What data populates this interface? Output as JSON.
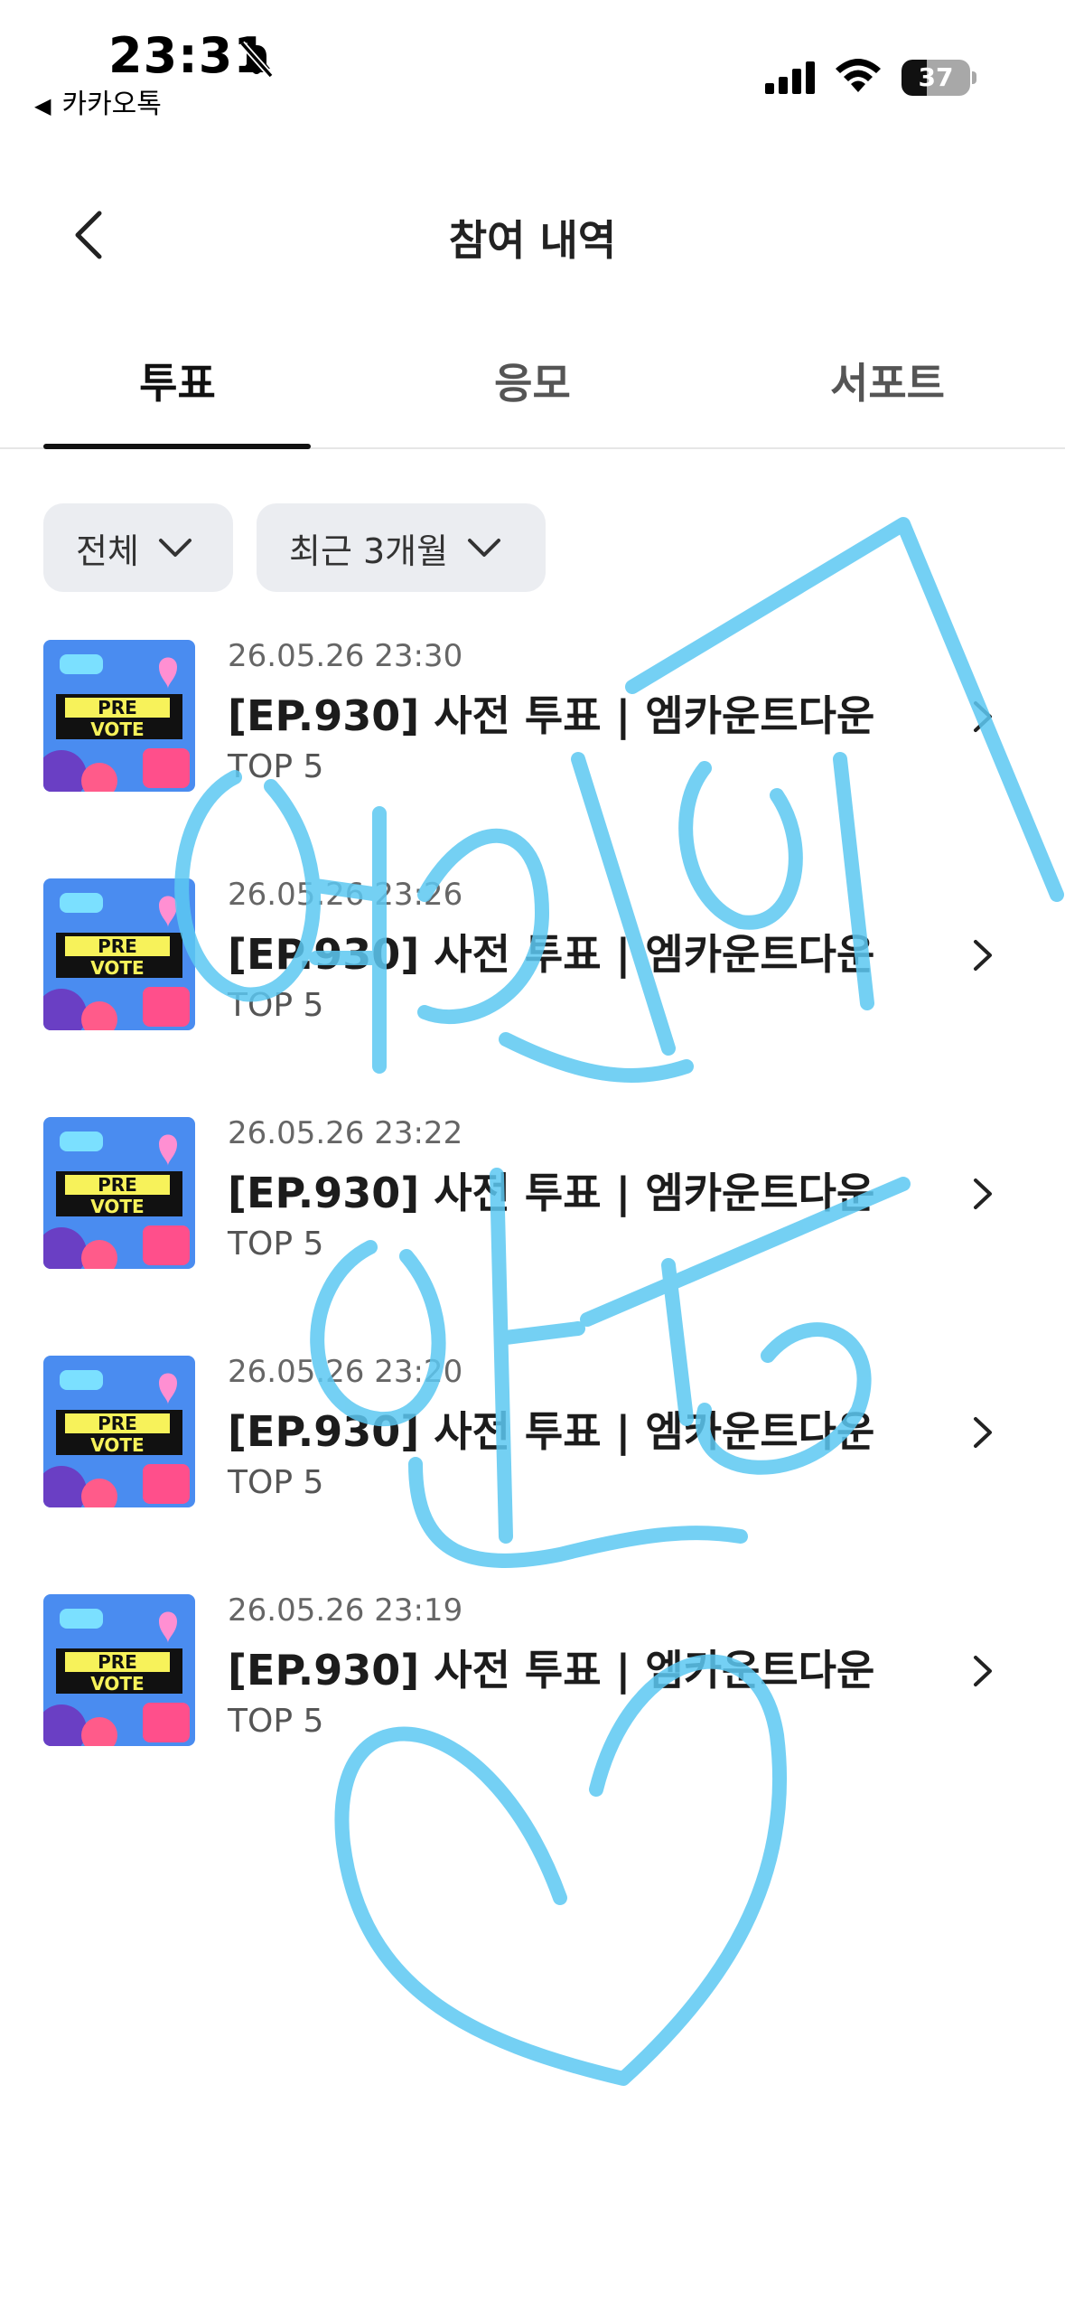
{
  "status_bar": {
    "time": "23:31",
    "back_app_label": "카카오톡",
    "battery": "37",
    "battery_level": 0.37,
    "icons": [
      "bell-slash-icon",
      "cellular-signal-icon",
      "wifi-icon",
      "battery-icon"
    ]
  },
  "header": {
    "title": "참여 내역",
    "back_icon": "chevron-left-icon"
  },
  "tabs": [
    {
      "label": "투표",
      "active": true
    },
    {
      "label": "응모",
      "active": false
    },
    {
      "label": "서포트",
      "active": false
    }
  ],
  "filters": {
    "type": "전체",
    "period": "최근 3개월"
  },
  "thumbnail": {
    "line1": "PRE",
    "line2": "VOTE"
  },
  "items": [
    {
      "date": "26.05.26 23:30",
      "title": "[EP.930] 사전 투표 | 엠카운트다운",
      "subtitle": "TOP 5"
    },
    {
      "date": "26.05.26 23:26",
      "title": "[EP.930] 사전 투표 | 엠카운트다운",
      "subtitle": "TOP 5"
    },
    {
      "date": "26.05.26 23:22",
      "title": "[EP.930] 사전 투표 | 엠카운트다운",
      "subtitle": "TOP 5"
    },
    {
      "date": "26.05.26 23:20",
      "title": "[EP.930] 사전 투표 | 엠카운트다운",
      "subtitle": "TOP 5"
    },
    {
      "date": "26.05.26 23:19",
      "title": "[EP.930] 사전 투표 | 엠카운트다운",
      "subtitle": "TOP 5"
    }
  ],
  "colors": {
    "scribble": "#5cc8f2",
    "chip_bg": "#ebedf1",
    "indicator": "#111111"
  }
}
